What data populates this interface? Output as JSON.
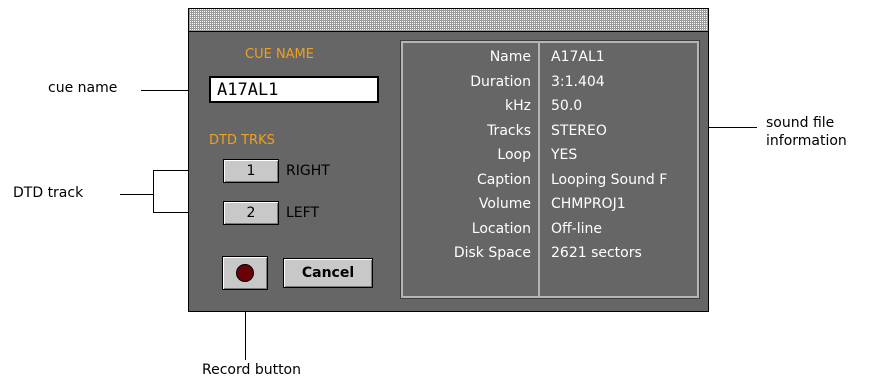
{
  "callouts": {
    "cue_name": "cue name",
    "dtd_track": "DTD track",
    "record_button": "Record button",
    "sound_file_line1": "sound file",
    "sound_file_line2": "information"
  },
  "dialog": {
    "cue_name_label": "CUE NAME",
    "cue_name_value": "A17AL1",
    "dtd_trks_label": "DTD TRKS",
    "tracks": [
      {
        "button": "1",
        "label": "RIGHT"
      },
      {
        "button": "2",
        "label": "LEFT"
      }
    ],
    "cancel_label": "Cancel",
    "record_color": "#6a0008",
    "accent_color": "#f0a020"
  },
  "sound_info": [
    {
      "key": "Name",
      "value": "A17AL1"
    },
    {
      "key": "Duration",
      "value": "3:1.404"
    },
    {
      "key": "kHz",
      "value": "50.0"
    },
    {
      "key": "Tracks",
      "value": "STEREO"
    },
    {
      "key": "Loop",
      "value": "YES"
    },
    {
      "key": "Caption",
      "value": "Looping Sound F"
    },
    {
      "key": "Volume",
      "value": "CHMPROJ1"
    },
    {
      "key": "Location",
      "value": "Off-line"
    },
    {
      "key": "Disk Space",
      "value": "2621 sectors"
    }
  ]
}
